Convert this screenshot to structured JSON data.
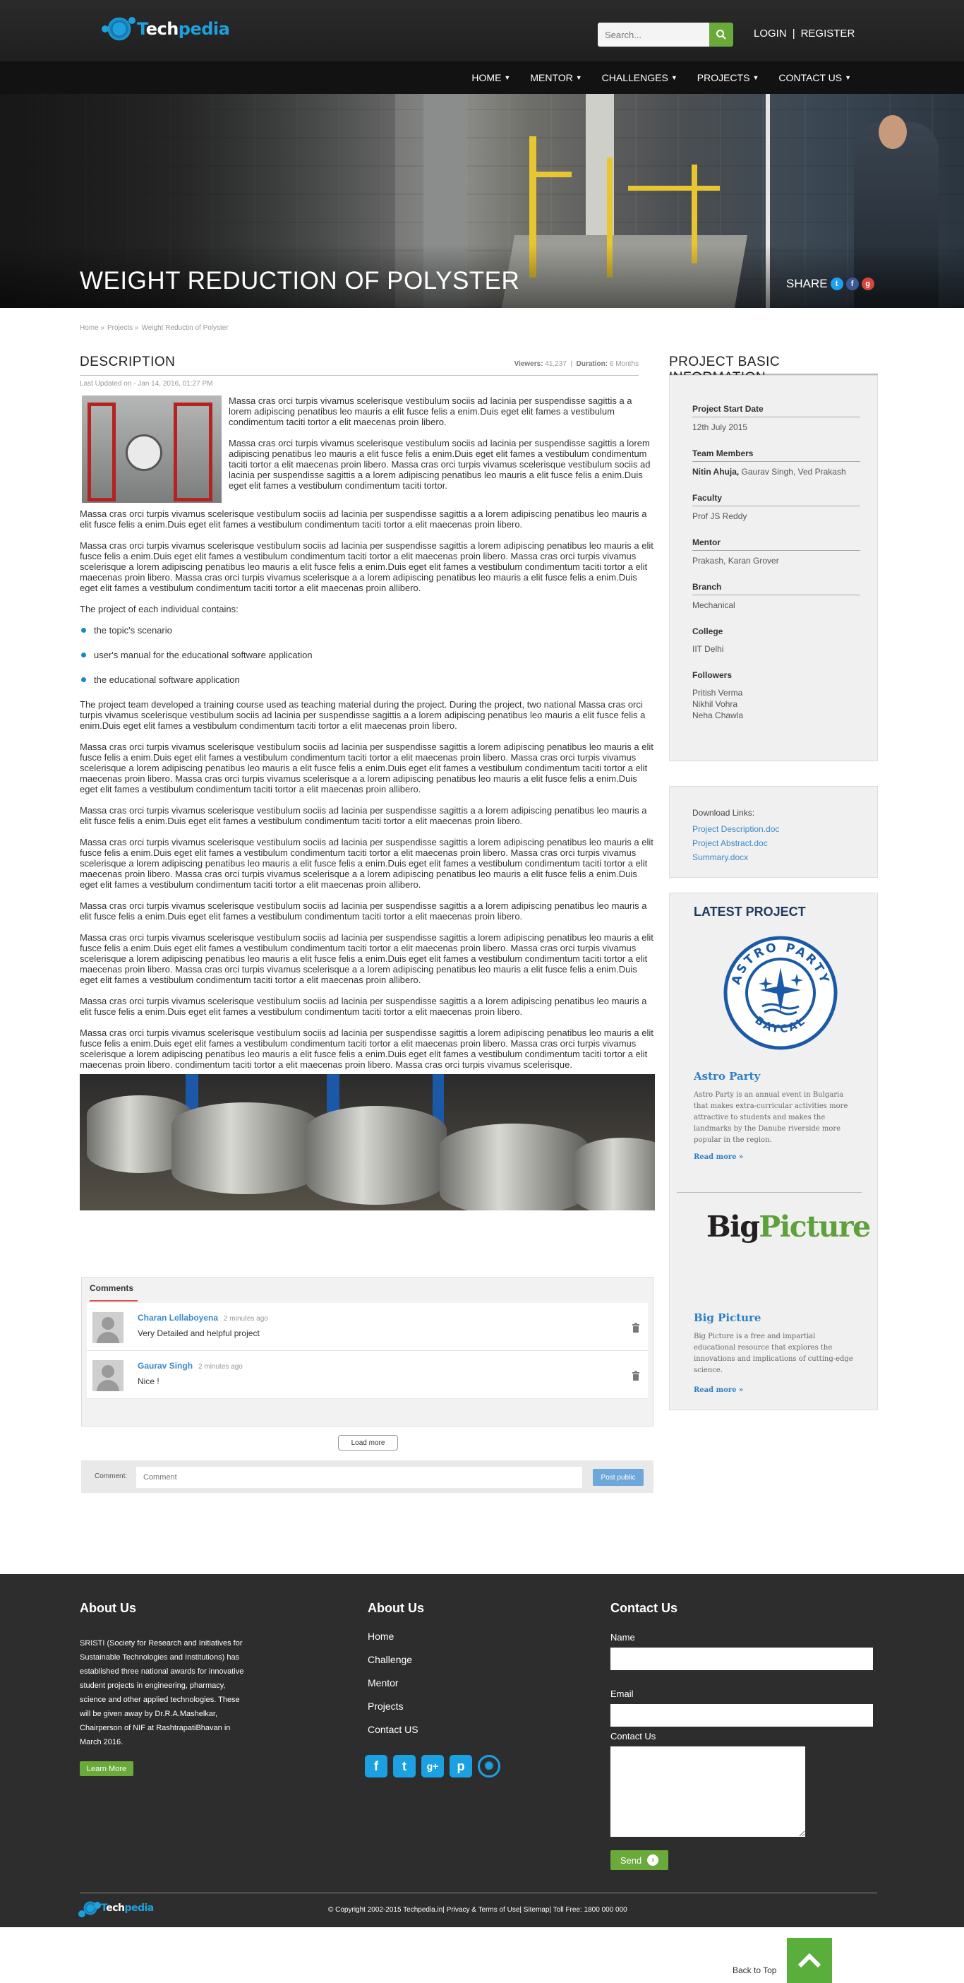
{
  "header": {
    "logo_prefix": "T",
    "logo_tech": "ech",
    "logo_pedia": "pedia",
    "search_placeholder": "Search...",
    "login": "LOGIN",
    "separator": "|",
    "register": "REGISTER",
    "nav": [
      "HOME",
      "MENTOR",
      "CHALLENGES",
      "PROJECTS",
      "CONTACT US"
    ]
  },
  "hero": {
    "title": "WEIGHT REDUCTION OF POLYSTER",
    "share_label": "SHARE",
    "share_icons": [
      "twitter-icon",
      "facebook-icon",
      "google-plus-icon"
    ]
  },
  "breadcrumb": [
    "Home »",
    "Projects »",
    "Weight Reductin of Polyster"
  ],
  "description": {
    "title": "DESCRIPTION",
    "viewers_label": "Viewers:",
    "viewers": "41,237",
    "duration_label": "Duration:",
    "duration": "6 Months",
    "updated": "Last Updated on - Jan 14, 2016, 01:27 PM",
    "p1": "Massa cras orci turpis vivamus scelerisque vestibulum sociis ad lacinia per suspendisse sagittis a a lorem adipiscing penatibus leo mauris a elit fusce felis a enim.Duis eget elit fames a vestibulum condimentum taciti tortor a elit maecenas proin libero.",
    "p2": "Massa cras orci turpis vivamus scelerisque vestibulum sociis ad lacinia per suspendisse sagittis a lorem adipiscing penatibus leo mauris a elit fusce felis a enim.Duis eget elit fames a vestibulum condimentum taciti tortor a elit maecenas proin libero. Massa cras orci turpis vivamus scelerisque vestibulum sociis ad lacinia per suspendisse sagittis a a lorem adipiscing penatibus leo mauris a elit fusce felis a enim.Duis eget elit fames a vestibulum condimentum taciti tortor.",
    "p3": "Massa cras orci turpis vivamus scelerisque vestibulum sociis ad lacinia per suspendisse sagittis a a lorem adipiscing penatibus  leo mauris a elit fusce felis a enim.Duis eget elit fames a vestibulum condimentum taciti tortor a elit maecenas proin libero.",
    "p4": "Massa cras orci turpis vivamus scelerisque vestibulum sociis ad lacinia per suspendisse sagittis a lorem adipiscing penatibus leo mauris a elit fusce felis a enim.Duis eget elit fames a vestibulum condimentum taciti tortor a elit maecenas proin libero. Massa cras orci turpis vivamus scelerisque a lorem adipiscing penatibus leo mauris a elit fusce felis a enim.Duis eget elit fames a vestibulum condimentum taciti tortor a elit maecenas proin libero. Massa cras orci turpis vivamus scelerisque a a lorem adipiscing penatibus leo mauris a elit fusce felis a enim.Duis eget elit fames a vestibulum condimentum taciti tortor a elit maecenas proin allibero.",
    "list_intro": "The project of each individual contains:",
    "bullets": [
      "the topic's scenario",
      "user's manual for the educational software application",
      "the educational software application"
    ],
    "p5": "The project team developed a training course used as teaching material during the project. During the project, two national Massa cras orci turpis vivamus scelerisque vestibulum sociis ad lacinia per suspendisse sagittis a a lorem adipiscing penatibus  leo mauris a elit fusce felis a enim.Duis eget elit fames a vestibulum condimentum taciti tortor a elit maecenas proin libero.",
    "p6": "Massa cras orci turpis vivamus scelerisque vestibulum sociis ad lacinia per suspendisse sagittis a lorem adipiscing penatibus leo mauris a elit fusce felis a enim.Duis eget elit fames a vestibulum condimentum taciti tortor a elit maecenas proin libero. Massa cras orci turpis vivamus scelerisque a lorem adipiscing penatibus leo mauris a elit fusce felis a enim.Duis eget elit fames a vestibulum condimentum taciti tortor a elit maecenas proin libero. Massa cras orci turpis vivamus scelerisque a a lorem adipiscing penatibus leo mauris a elit fusce felis a enim.Duis eget elit fames a vestibulum condimentum taciti tortor a elit maecenas proin allibero.",
    "p7": "Massa cras orci turpis vivamus scelerisque vestibulum sociis ad lacinia per suspendisse sagittis a a lorem adipiscing penatibus  leo mauris a elit fusce felis a enim.Duis eget elit fames a vestibulum condimentum taciti tortor a elit maecenas proin libero.",
    "p8": "Massa cras orci turpis vivamus scelerisque vestibulum sociis ad lacinia per suspendisse sagittis a lorem adipiscing penatibus leo mauris a elit fusce felis a enim.Duis eget elit fames a vestibulum condimentum taciti tortor a elit maecenas proin libero. Massa cras orci turpis vivamus scelerisque a lorem adipiscing penatibus leo mauris a elit fusce felis a enim.Duis eget elit fames a vestibulum condimentum taciti tortor a elit maecenas proin libero. Massa cras orci turpis vivamus scelerisque a a lorem adipiscing penatibus leo mauris a elit fusce felis a enim.Duis eget elit fames a vestibulum condimentum taciti tortor a elit maecenas proin allibero.",
    "p9": "Massa cras orci turpis vivamus scelerisque vestibulum sociis ad lacinia per suspendisse sagittis a a lorem adipiscing penatibus  leo mauris a elit fusce felis a enim.Duis eget elit fames a vestibulum condimentum taciti tortor a elit maecenas proin libero.",
    "p10": "Massa cras orci turpis vivamus scelerisque vestibulum sociis ad lacinia per suspendisse sagittis a lorem adipiscing penatibus leo mauris a elit fusce felis a enim.Duis eget elit fames a vestibulum condimentum taciti tortor a elit maecenas proin libero. Massa cras orci turpis vivamus scelerisque a lorem adipiscing penatibus leo mauris a elit fusce felis a enim.Duis eget elit fames a vestibulum condimentum taciti tortor a elit maecenas proin libero. Massa cras orci turpis vivamus scelerisque a a lorem adipiscing penatibus leo mauris a elit fusce felis a enim.Duis eget elit fames a vestibulum condimentum taciti tortor a elit maecenas proin allibero.",
    "p11": "Massa cras orci turpis vivamus scelerisque vestibulum sociis ad lacinia per suspendisse sagittis a a lorem adipiscing penatibus  leo mauris a elit fusce felis a enim.Duis eget elit fames a vestibulum condimentum taciti tortor a elit maecenas proin libero.",
    "p12": "Massa cras orci turpis vivamus scelerisque vestibulum sociis ad lacinia per suspendisse sagittis a lorem adipiscing penatibus leo mauris a elit fusce felis a enim.Duis eget elit fames a vestibulum condimentum taciti tortor a elit maecenas proin libero. Massa cras orci turpis vivamus scelerisque a lorem adipiscing penatibus leo mauris a elit fusce felis a enim.Duis eget elit fames a vestibulum condimentum taciti tortor a elit maecenas proin libero. condimentum taciti tortor a elit maecenas proin libero. Massa cras orci turpis vivamus scelerisque."
  },
  "comments": {
    "tab": "Comments",
    "items": [
      {
        "name": "Charan Lellaboyena",
        "time": "2 minutes ago",
        "text": "Very Detailed and helpful project"
      },
      {
        "name": "Gaurav Singh",
        "time": "2 minutes ago",
        "text": "Nice !"
      }
    ],
    "load_more": "Load more",
    "post_label": "Comment:",
    "post_placeholder": "Comment",
    "post_button": "Post public"
  },
  "sidebar": {
    "title": "PROJECT BASIC INFORMATION",
    "start_label": "Project Start Date",
    "start_value": "12th July 2015",
    "team_label": "Team Members",
    "team_lead": "Nitin Ahuja,",
    "team_rest": " Gaurav Singh, Ved Prakash",
    "faculty_label": "Faculty",
    "faculty_value": "Prof JS Reddy",
    "mentor_label": "Mentor",
    "mentor_value": "Prakash, Karan Grover",
    "branch_label": "Branch",
    "branch_value": "Mechanical",
    "college_label": "College",
    "college_value": "IIT Delhi",
    "followers_label": "Followers",
    "followers": [
      "Pritish Verma",
      "Nikhil Vohra",
      "Neha Chawla"
    ],
    "downloads_title": "Download Links:",
    "downloads": [
      "Project Description.doc",
      "Project Abstract.doc",
      "Summary.docx"
    ],
    "latest_title": "LATEST PROJECT",
    "astro_logo_top": "ASTRO PARTY",
    "astro_logo_bottom": "BAYCAL",
    "astro_name": "Astro Party",
    "astro_desc": "Astro Party is an annual event in Bulgaria that makes extra-curricular activities more attractive to students and makes the landmarks by the Danube riverside more popular in the region.",
    "read_more": "Read more »",
    "bp_big": "Big",
    "bp_picture": "Picture",
    "bp_name": "Big Picture",
    "bp_desc": "Big Picture is a free and impartial educational resource that explores the innovations and implications of cutting-edge science."
  },
  "footer": {
    "about_title": "About Us",
    "about_text": "SRISTI (Society for Research and Initiatives for Sustainable Technologies and Institutions) has established three national awards for innovative student projects in engineering, pharmacy, science and other applied technologies. These will be given away by Dr.R.A.Mashelkar, Chairperson of NIF at RashtrapatiBhavan in March 2016.",
    "learn_more": "Learn More",
    "links_title": "About Us",
    "links": [
      "Home",
      "Challenge",
      "Mentor",
      "Projects",
      "Contact US"
    ],
    "social": [
      "facebook-icon",
      "twitter-icon",
      "google-plus-icon",
      "pinterest-icon",
      "dribbble-icon"
    ],
    "contact_title": "Contact Us",
    "name_label": "Name",
    "email_label": "Email",
    "message_label": "Contact Us",
    "send": "Send",
    "copyright": "© Copyright 2002-2015 Techpedia.in| Privacy & Terms of Use| Sitemap| Toll Free: 1800 000 000",
    "back_to_top": "Back to Top"
  },
  "colors": {
    "accent_green": "#6aaa3a",
    "link_blue": "#3a8ac8",
    "brand_blue": "#1fa0dc",
    "footer_bg": "#2d2d2d"
  }
}
